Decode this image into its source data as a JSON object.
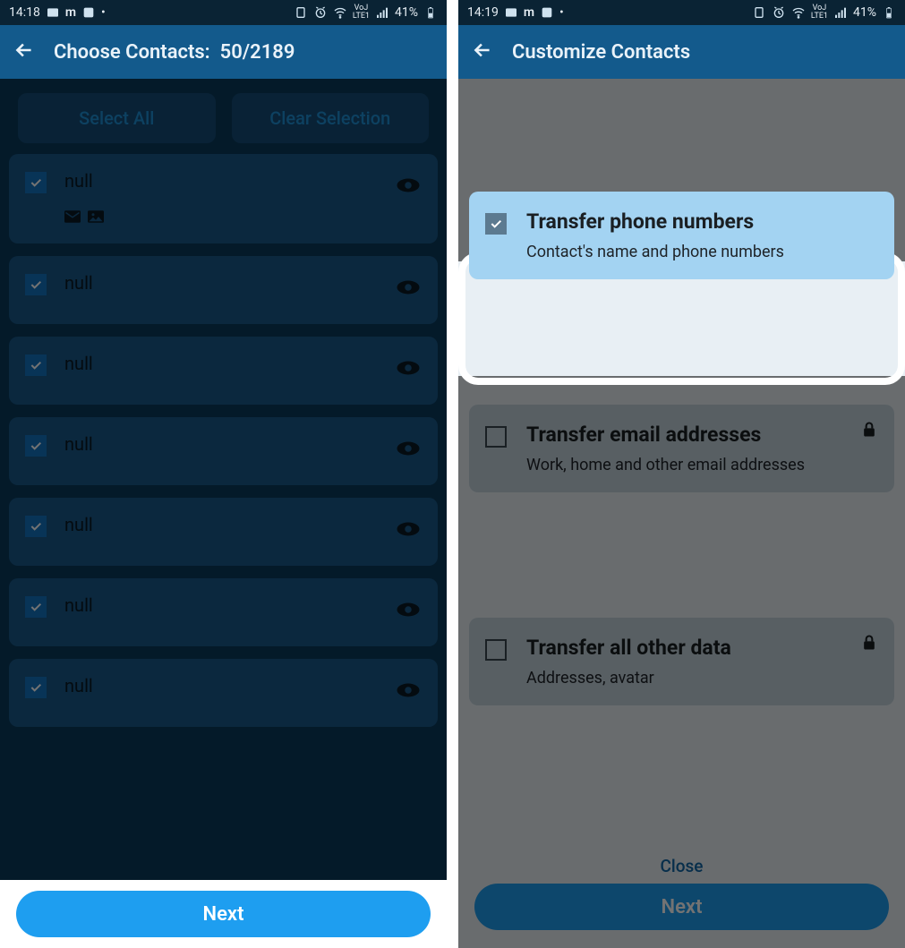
{
  "left": {
    "status": {
      "time": "14:18",
      "battery": "41%"
    },
    "appbar": {
      "title": "Choose Contacts:",
      "count": "50/2189"
    },
    "buttons": {
      "select_all": "Select All",
      "clear": "Clear Selection"
    },
    "contacts": [
      {
        "name": "null",
        "checked": true,
        "has_sub": true
      },
      {
        "name": "null",
        "checked": true,
        "has_sub": false
      },
      {
        "name": "null",
        "checked": true,
        "has_sub": false
      },
      {
        "name": "null",
        "checked": true,
        "has_sub": false
      },
      {
        "name": "null",
        "checked": true,
        "has_sub": false
      },
      {
        "name": "null",
        "checked": true,
        "has_sub": false
      },
      {
        "name": "null",
        "checked": true,
        "has_sub": false
      }
    ],
    "next": "Next"
  },
  "right": {
    "status": {
      "time": "14:19",
      "battery": "41%"
    },
    "appbar": {
      "title": "Customize Contacts"
    },
    "options": [
      {
        "title": "Transfer phone numbers",
        "sub": "Contact's name and phone numbers",
        "checked": true,
        "locked": false,
        "highlight": true
      },
      {
        "title": "Transfer email addresses",
        "sub": "Work, home and other email addresses",
        "checked": false,
        "locked": true,
        "highlight": false
      },
      {
        "title": "Transfer all other data",
        "sub": "Addresses, avatar",
        "checked": false,
        "locked": true,
        "highlight": false
      }
    ],
    "close": "Close",
    "next": "Next"
  }
}
